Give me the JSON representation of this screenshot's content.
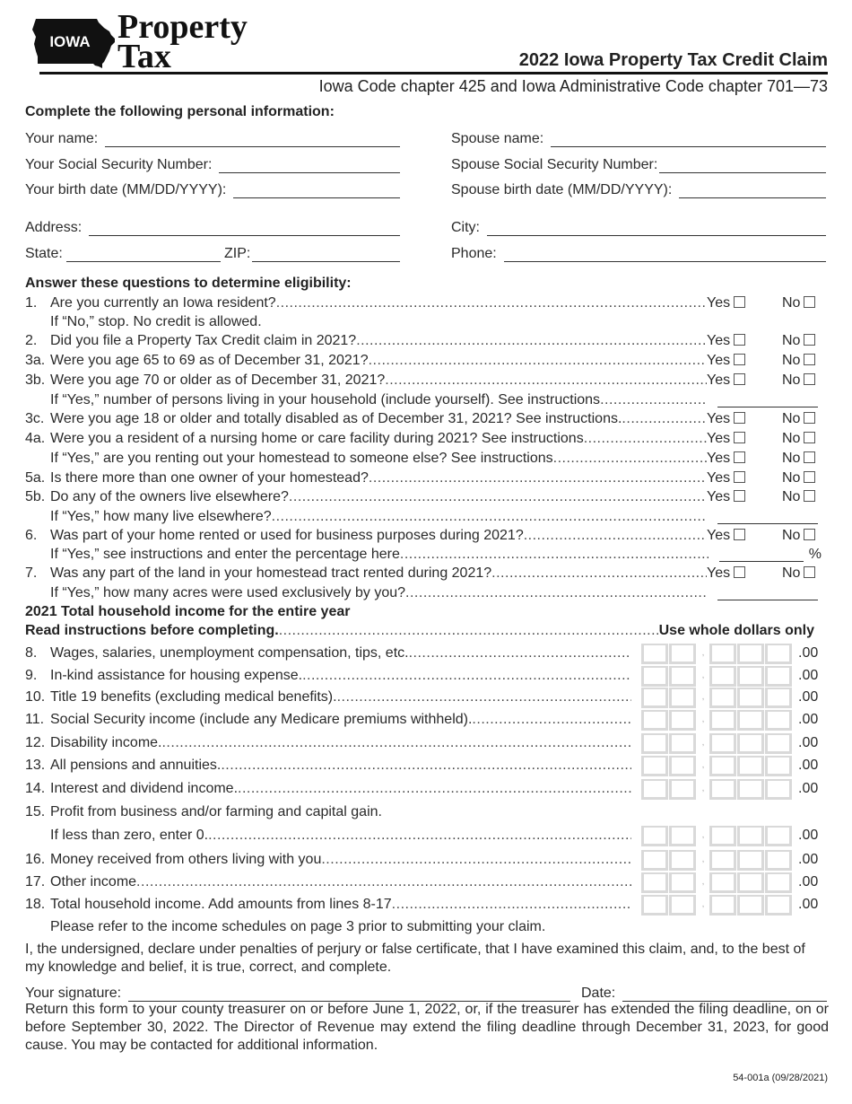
{
  "header": {
    "logo_state": "IOWA",
    "logo_line1": "Property",
    "logo_line2": "Tax",
    "title": "2022 Iowa Property Tax Credit Claim",
    "subtitle": "Iowa Code chapter 425 and Iowa Administrative Code chapter 701—73"
  },
  "personal": {
    "heading": "Complete the following personal information:",
    "left": [
      {
        "label": "Your name:",
        "value": ""
      },
      {
        "label": "Your Social Security Number:",
        "value": ""
      },
      {
        "label": "Your birth date (MM/DD/YYYY):",
        "value": ""
      },
      {
        "label": "Address:",
        "value": ""
      }
    ],
    "state_label": "State:",
    "zip_label": "ZIP:",
    "right": [
      {
        "label": "Spouse name:",
        "value": ""
      },
      {
        "label": "Spouse Social Security Number:",
        "value": ""
      },
      {
        "label": "Spouse birth date (MM/DD/YYYY):",
        "value": ""
      },
      {
        "label": "City:",
        "value": ""
      },
      {
        "label": "Phone:",
        "value": ""
      }
    ]
  },
  "eligibility": {
    "heading": "Answer these questions to determine eligibility:",
    "yes_label": "Yes",
    "no_label": "No",
    "percent_sign": "%",
    "rows": [
      {
        "num": "1.",
        "text": "Are you currently an Iowa resident?",
        "type": "yesno"
      },
      {
        "num": "",
        "text": "If “No,” stop. No credit is allowed.",
        "type": "note"
      },
      {
        "num": "2.",
        "text": "Did you file a Property Tax Credit claim in 2021?",
        "type": "yesno"
      },
      {
        "num": "3a.",
        "text": "Were you age 65 to 69 as of December 31, 2021?",
        "type": "yesno"
      },
      {
        "num": "3b.",
        "text": "Were you age 70 or older as of December 31, 2021?",
        "type": "yesno"
      },
      {
        "num": "",
        "text": "If “Yes,” number of persons living in your household (include yourself). See instructions",
        "type": "blank"
      },
      {
        "num": "3c.",
        "text": "Were you age 18 or older and totally disabled as of December 31, 2021? See instructions. ",
        "type": "yesno"
      },
      {
        "num": "4a.",
        "text": "Were you a resident of a nursing home or care facility during 2021? See instructions",
        "type": "yesno"
      },
      {
        "num": "",
        "text": "If “Yes,” are you renting out your homestead to someone else? See instructions ",
        "type": "yesno"
      },
      {
        "num": "5a.",
        "text": "Is there more than one owner of your homestead?",
        "type": "yesno"
      },
      {
        "num": "5b.",
        "text": "Do any of the owners live elsewhere?",
        "type": "yesno"
      },
      {
        "num": "",
        "text": "If “Yes,” how many live elsewhere?",
        "type": "blank"
      },
      {
        "num": "6.",
        "text": "Was part of your home rented or used for business purposes during 2021?",
        "type": "yesno"
      },
      {
        "num": "",
        "text": "If “Yes,” see instructions and enter the percentage here",
        "type": "percent"
      },
      {
        "num": "7.",
        "text": "Was any part of the land in your homestead tract rented during 2021?",
        "type": "yesno"
      },
      {
        "num": "",
        "text": "If “Yes,” how many acres were used exclusively by you? ",
        "type": "blank"
      }
    ]
  },
  "income": {
    "heading1": "2021 Total household income for the entire year",
    "heading2": "Read instructions before completing.",
    "whole_dollars": "Use whole dollars only",
    "cents": ".00",
    "comma": ",",
    "rows": [
      {
        "num": "8.",
        "text": "Wages, salaries, unemployment compensation, tips, etc.",
        "value": ""
      },
      {
        "num": "9.",
        "text": "In-kind assistance for housing expense.",
        "value": ""
      },
      {
        "num": "10.",
        "text": "Title 19 benefits (excluding medical benefits).",
        "value": ""
      },
      {
        "num": "11.",
        "text": "Social Security income (include any Medicare premiums withheld).",
        "value": ""
      },
      {
        "num": "12.",
        "text": "Disability income.",
        "value": ""
      },
      {
        "num": "13.",
        "text": "All pensions and annuities.",
        "value": ""
      },
      {
        "num": "14.",
        "text": "Interest and dividend income.",
        "value": ""
      },
      {
        "num": "15.",
        "text": "Profit from business and/or farming and capital gain.",
        "text2": "If less than zero, enter 0. ",
        "value": ""
      },
      {
        "num": "16.",
        "text": "Money received from others living with you",
        "value": ""
      },
      {
        "num": "17.",
        "text": "Other income ",
        "value": ""
      },
      {
        "num": "18.",
        "text": "Total household income. Add amounts from lines 8-17",
        "value": ""
      }
    ],
    "note": "Please refer to the income schedules on page 3 prior to submitting your claim."
  },
  "declaration": {
    "text": "I, the undersigned, declare under penalties of perjury or false certificate, that I have examined this claim, and, to the best of my knowledge and belief, it is true, correct, and complete.",
    "signature_label": "Your signature:",
    "date_label": "Date:",
    "return_text": "Return this form to your county treasurer on or before June 1, 2022, or, if the treasurer has extended the filing deadline, on or before September 30, 2022. The Director of Revenue may extend the filing deadline through December 31, 2023, for good cause. You may be contacted for additional information."
  },
  "footer": {
    "form_id": "54-001a (09/28/2021)"
  }
}
